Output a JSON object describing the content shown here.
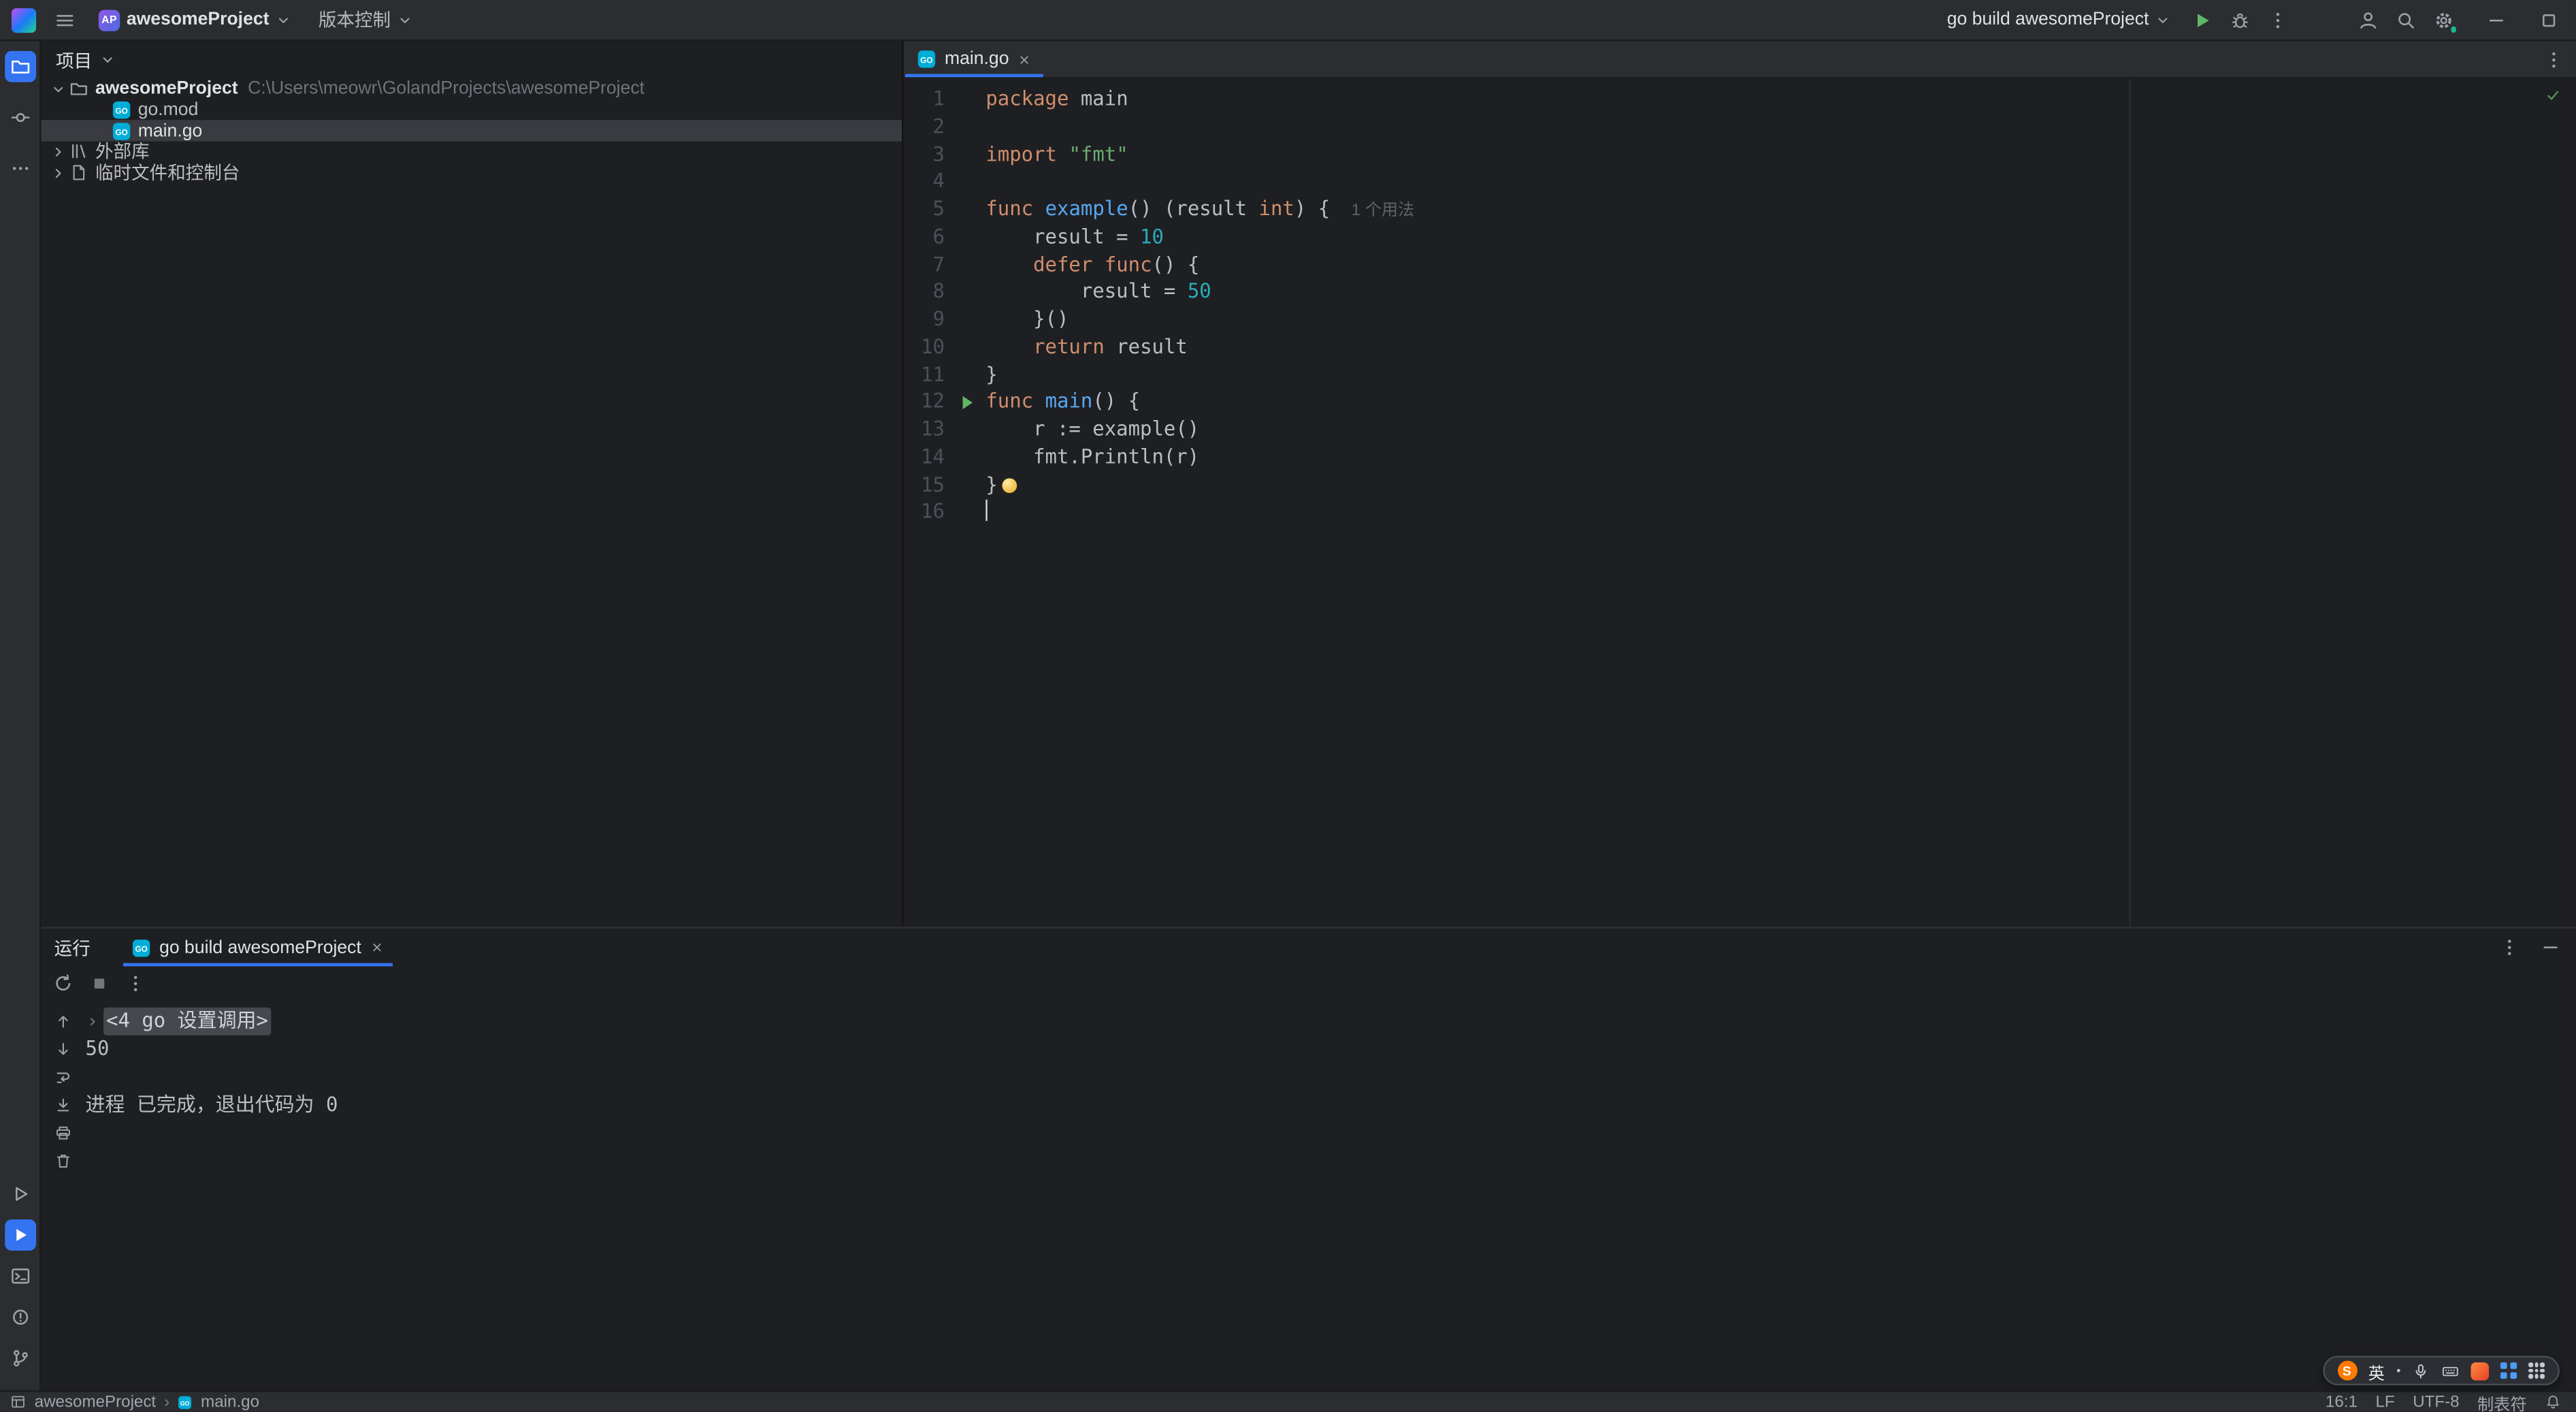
{
  "palette": {
    "chrome_bg": "#2B2D30",
    "editor_bg": "#1E1F22",
    "accent_blue": "#3574F0",
    "selection_gray": "#393B40",
    "text_primary": "#DFE1E5",
    "text_default": "#BCBEC4",
    "icon_gray": "#9DA0A8",
    "line_number": "#4B5059",
    "keyword": "#CF8E6D",
    "string": "#6AAB73",
    "number": "#2AACB8",
    "function_decl": "#56A8F5",
    "inlay_hint": "#606368",
    "run_green": "#5FB865",
    "success_green": "#549159",
    "fold_bg": "#45484D",
    "sogou_orange": "#FF7A00"
  },
  "title_bar": {
    "project_badge": "AP",
    "project_name": "awesomeProject",
    "vcs_label": "版本控制",
    "run_config": "go build awesomeProject"
  },
  "project_panel": {
    "header": "项目",
    "items": [
      {
        "depth": 0,
        "chevron": "down",
        "icon": "folder-icon",
        "label": "awesomeProject",
        "bold": true,
        "path": "C:\\Users\\meowr\\GolandProjects\\awesomeProject",
        "selected": false
      },
      {
        "depth": 1,
        "chevron": null,
        "icon": "go-file-icon",
        "label": "go.mod",
        "selected": false
      },
      {
        "depth": 1,
        "chevron": null,
        "icon": "go-file-icon",
        "label": "main.go",
        "selected": true
      },
      {
        "depth": 0,
        "chevron": "right",
        "icon": "library-icon",
        "label": "外部库",
        "selected": false
      },
      {
        "depth": 0,
        "chevron": "right",
        "icon": "scratches-icon",
        "label": "临时文件和控制台",
        "selected": false
      }
    ]
  },
  "editor": {
    "tab_label": "main.go",
    "inspection_status": "ok",
    "lines": [
      {
        "n": 1,
        "seg": [
          [
            "kw",
            "package"
          ],
          [
            "tx",
            " main"
          ]
        ]
      },
      {
        "n": 2,
        "seg": []
      },
      {
        "n": 3,
        "seg": [
          [
            "kw",
            "import"
          ],
          [
            "tx",
            " "
          ],
          [
            "str",
            "\"fmt\""
          ]
        ]
      },
      {
        "n": 4,
        "seg": []
      },
      {
        "n": 5,
        "seg": [
          [
            "kw",
            "func"
          ],
          [
            "tx",
            " "
          ],
          [
            "fn",
            "example"
          ],
          [
            "tx",
            "() (result "
          ],
          [
            "kw",
            "int"
          ],
          [
            "tx",
            ") {"
          ]
        ],
        "hint": "1 个用法"
      },
      {
        "n": 6,
        "seg": [
          [
            "tx",
            "    result = "
          ],
          [
            "num",
            "10"
          ]
        ]
      },
      {
        "n": 7,
        "seg": [
          [
            "tx",
            "    "
          ],
          [
            "kw",
            "defer"
          ],
          [
            "tx",
            " "
          ],
          [
            "kw",
            "func"
          ],
          [
            "tx",
            "() {"
          ]
        ]
      },
      {
        "n": 8,
        "seg": [
          [
            "tx",
            "        result = "
          ],
          [
            "num",
            "50"
          ]
        ]
      },
      {
        "n": 9,
        "seg": [
          [
            "tx",
            "    }()"
          ]
        ]
      },
      {
        "n": 10,
        "seg": [
          [
            "tx",
            "    "
          ],
          [
            "kw",
            "return"
          ],
          [
            "tx",
            " result"
          ]
        ]
      },
      {
        "n": 11,
        "seg": [
          [
            "tx",
            "}"
          ]
        ]
      },
      {
        "n": 12,
        "seg": [
          [
            "kw",
            "func"
          ],
          [
            "tx",
            " "
          ],
          [
            "fn",
            "main"
          ],
          [
            "tx",
            "() {"
          ]
        ],
        "run": true
      },
      {
        "n": 13,
        "seg": [
          [
            "tx",
            "    r := example()"
          ]
        ]
      },
      {
        "n": 14,
        "seg": [
          [
            "tx",
            "    fmt.Println(r)"
          ]
        ]
      },
      {
        "n": 15,
        "seg": [
          [
            "tx",
            "}"
          ]
        ],
        "bulb": true
      },
      {
        "n": 16,
        "seg": [],
        "caret": true
      }
    ]
  },
  "run_panel": {
    "title": "运行",
    "tab_label": "go build awesomeProject",
    "console_lines": [
      {
        "fold": true,
        "text": "<4 go 设置调用>"
      },
      {
        "text": "50"
      },
      {
        "text": ""
      },
      {
        "text": "进程 已完成，退出代码为 0"
      }
    ]
  },
  "status_bar": {
    "breadcrumb_project": "awesomeProject",
    "breadcrumb_separator": "›",
    "breadcrumb_file": "main.go",
    "caret_position": "16:1",
    "line_separator": "LF",
    "encoding": "UTF-8",
    "indent_style": "制表符"
  },
  "ime_bar": {
    "logo_letter": "S",
    "lang_label": "英"
  },
  "icons": {
    "goland-logo": "gradient-square",
    "menu-icon": "hamburger",
    "chevron-down-icon": "chevron-down",
    "chevron-right-icon": "chevron-right",
    "run-icon": "green-play-triangle",
    "debug-icon": "bug",
    "more-icon": "kebab-dots",
    "user-icon": "person",
    "search-icon": "magnifier",
    "settings-icon": "gear-with-update-dot",
    "minimize-icon": "dash",
    "maximize-icon": "square",
    "project-tool-icon": "folder-active-blue",
    "commit-tool-icon": "circle-with-lines",
    "more-tools-icon": "ellipsis",
    "services-icon": "play-outline",
    "run-tool-icon": "play-active-blue",
    "terminal-icon": "prompt-window",
    "problems-icon": "circle-exclamation",
    "vcs-branch-icon": "git-branch",
    "folder-icon": "folder",
    "go-file-icon": "cyan-GO-square",
    "library-icon": "book-stack",
    "scratches-icon": "file-with-fold",
    "close-icon": "x",
    "rerun-icon": "circular-arrow",
    "stop-icon": "gray-square",
    "up-icon": "arrow-up",
    "down-icon": "arrow-down",
    "softwrap-icon": "wrap-return-arrow",
    "scroll-end-icon": "arrow-to-line",
    "print-icon": "printer",
    "clear-icon": "trash",
    "inspections-ok-icon": "green-check",
    "tool-windows-icon": "window-grid",
    "notifications-icon": "bell",
    "fold-expand-icon": "small-right-chevron",
    "intention-bulb-icon": "yellow-bulb",
    "mic-icon": "microphone",
    "keyboard-icon": "keyboard",
    "skin-icon": "orange-gradient-square",
    "apps-grid-icon": "blue-2x2-grid",
    "toolbox-icon": "dot-3x3-grid",
    "sogou-logo": "orange-circle-S"
  }
}
